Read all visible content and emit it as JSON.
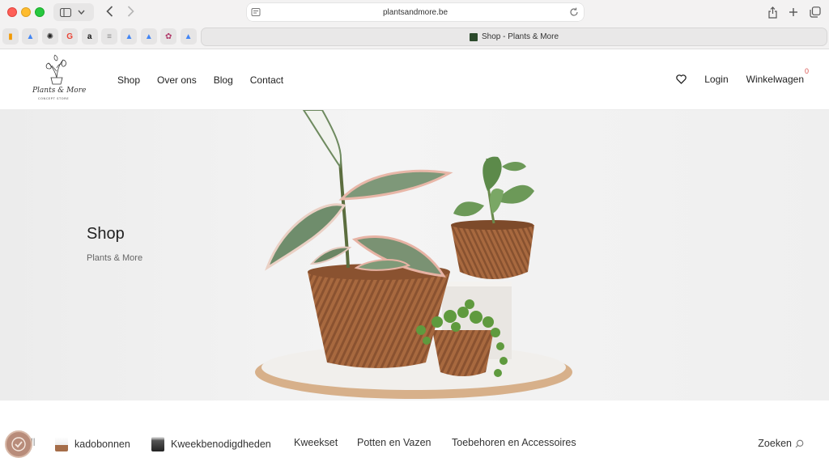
{
  "browser": {
    "url": "plantsandmore.be",
    "tab_title": "Shop - Plants & More",
    "favorites": [
      {
        "name": "analytics-icon",
        "glyph": "▮",
        "color": "#f29900"
      },
      {
        "name": "google-ads-icon",
        "glyph": "▲",
        "color": "#4285f4"
      },
      {
        "name": "openai-icon",
        "glyph": "✺",
        "color": "#222222"
      },
      {
        "name": "google-icon",
        "glyph": "G",
        "color": "#ea4335"
      },
      {
        "name": "amazon-icon",
        "glyph": "a",
        "color": "#111111"
      },
      {
        "name": "page-icon",
        "glyph": "≡",
        "color": "#888888"
      },
      {
        "name": "google-ads-icon",
        "glyph": "▲",
        "color": "#4285f4"
      },
      {
        "name": "google-ads-icon",
        "glyph": "▲",
        "color": "#4285f4"
      },
      {
        "name": "site-icon",
        "glyph": "✿",
        "color": "#b03a6a"
      },
      {
        "name": "google-ads-icon",
        "glyph": "▲",
        "color": "#4285f4"
      }
    ]
  },
  "header": {
    "nav": [
      "Shop",
      "Over ons",
      "Blog",
      "Contact"
    ],
    "login_label": "Login",
    "cart_label": "Winkelwagen",
    "cart_count": "0"
  },
  "hero": {
    "title": "Shop",
    "subtitle": "Plants & More"
  },
  "categories": {
    "partial_label": "ll",
    "items": [
      "kadobonnen",
      "Kweekbenodigdheden",
      "Kweekset",
      "Potten en Vazen",
      "Toebehoren en Accessoires"
    ],
    "search_label": "Zoeken"
  },
  "colors": {
    "accent": "#d9534f",
    "pot": "#a8693f",
    "leaf": "#5d7a5a"
  }
}
